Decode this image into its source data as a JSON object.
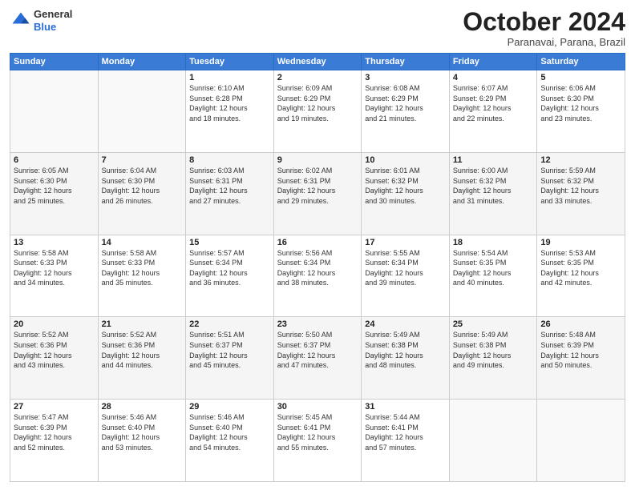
{
  "header": {
    "logo_general": "General",
    "logo_blue": "Blue",
    "month": "October 2024",
    "location": "Paranavai, Parana, Brazil"
  },
  "days_of_week": [
    "Sunday",
    "Monday",
    "Tuesday",
    "Wednesday",
    "Thursday",
    "Friday",
    "Saturday"
  ],
  "weeks": [
    [
      {
        "day": "",
        "info": ""
      },
      {
        "day": "",
        "info": ""
      },
      {
        "day": "1",
        "info": "Sunrise: 6:10 AM\nSunset: 6:28 PM\nDaylight: 12 hours\nand 18 minutes."
      },
      {
        "day": "2",
        "info": "Sunrise: 6:09 AM\nSunset: 6:29 PM\nDaylight: 12 hours\nand 19 minutes."
      },
      {
        "day": "3",
        "info": "Sunrise: 6:08 AM\nSunset: 6:29 PM\nDaylight: 12 hours\nand 21 minutes."
      },
      {
        "day": "4",
        "info": "Sunrise: 6:07 AM\nSunset: 6:29 PM\nDaylight: 12 hours\nand 22 minutes."
      },
      {
        "day": "5",
        "info": "Sunrise: 6:06 AM\nSunset: 6:30 PM\nDaylight: 12 hours\nand 23 minutes."
      }
    ],
    [
      {
        "day": "6",
        "info": "Sunrise: 6:05 AM\nSunset: 6:30 PM\nDaylight: 12 hours\nand 25 minutes."
      },
      {
        "day": "7",
        "info": "Sunrise: 6:04 AM\nSunset: 6:30 PM\nDaylight: 12 hours\nand 26 minutes."
      },
      {
        "day": "8",
        "info": "Sunrise: 6:03 AM\nSunset: 6:31 PM\nDaylight: 12 hours\nand 27 minutes."
      },
      {
        "day": "9",
        "info": "Sunrise: 6:02 AM\nSunset: 6:31 PM\nDaylight: 12 hours\nand 29 minutes."
      },
      {
        "day": "10",
        "info": "Sunrise: 6:01 AM\nSunset: 6:32 PM\nDaylight: 12 hours\nand 30 minutes."
      },
      {
        "day": "11",
        "info": "Sunrise: 6:00 AM\nSunset: 6:32 PM\nDaylight: 12 hours\nand 31 minutes."
      },
      {
        "day": "12",
        "info": "Sunrise: 5:59 AM\nSunset: 6:32 PM\nDaylight: 12 hours\nand 33 minutes."
      }
    ],
    [
      {
        "day": "13",
        "info": "Sunrise: 5:58 AM\nSunset: 6:33 PM\nDaylight: 12 hours\nand 34 minutes."
      },
      {
        "day": "14",
        "info": "Sunrise: 5:58 AM\nSunset: 6:33 PM\nDaylight: 12 hours\nand 35 minutes."
      },
      {
        "day": "15",
        "info": "Sunrise: 5:57 AM\nSunset: 6:34 PM\nDaylight: 12 hours\nand 36 minutes."
      },
      {
        "day": "16",
        "info": "Sunrise: 5:56 AM\nSunset: 6:34 PM\nDaylight: 12 hours\nand 38 minutes."
      },
      {
        "day": "17",
        "info": "Sunrise: 5:55 AM\nSunset: 6:34 PM\nDaylight: 12 hours\nand 39 minutes."
      },
      {
        "day": "18",
        "info": "Sunrise: 5:54 AM\nSunset: 6:35 PM\nDaylight: 12 hours\nand 40 minutes."
      },
      {
        "day": "19",
        "info": "Sunrise: 5:53 AM\nSunset: 6:35 PM\nDaylight: 12 hours\nand 42 minutes."
      }
    ],
    [
      {
        "day": "20",
        "info": "Sunrise: 5:52 AM\nSunset: 6:36 PM\nDaylight: 12 hours\nand 43 minutes."
      },
      {
        "day": "21",
        "info": "Sunrise: 5:52 AM\nSunset: 6:36 PM\nDaylight: 12 hours\nand 44 minutes."
      },
      {
        "day": "22",
        "info": "Sunrise: 5:51 AM\nSunset: 6:37 PM\nDaylight: 12 hours\nand 45 minutes."
      },
      {
        "day": "23",
        "info": "Sunrise: 5:50 AM\nSunset: 6:37 PM\nDaylight: 12 hours\nand 47 minutes."
      },
      {
        "day": "24",
        "info": "Sunrise: 5:49 AM\nSunset: 6:38 PM\nDaylight: 12 hours\nand 48 minutes."
      },
      {
        "day": "25",
        "info": "Sunrise: 5:49 AM\nSunset: 6:38 PM\nDaylight: 12 hours\nand 49 minutes."
      },
      {
        "day": "26",
        "info": "Sunrise: 5:48 AM\nSunset: 6:39 PM\nDaylight: 12 hours\nand 50 minutes."
      }
    ],
    [
      {
        "day": "27",
        "info": "Sunrise: 5:47 AM\nSunset: 6:39 PM\nDaylight: 12 hours\nand 52 minutes."
      },
      {
        "day": "28",
        "info": "Sunrise: 5:46 AM\nSunset: 6:40 PM\nDaylight: 12 hours\nand 53 minutes."
      },
      {
        "day": "29",
        "info": "Sunrise: 5:46 AM\nSunset: 6:40 PM\nDaylight: 12 hours\nand 54 minutes."
      },
      {
        "day": "30",
        "info": "Sunrise: 5:45 AM\nSunset: 6:41 PM\nDaylight: 12 hours\nand 55 minutes."
      },
      {
        "day": "31",
        "info": "Sunrise: 5:44 AM\nSunset: 6:41 PM\nDaylight: 12 hours\nand 57 minutes."
      },
      {
        "day": "",
        "info": ""
      },
      {
        "day": "",
        "info": ""
      }
    ]
  ]
}
